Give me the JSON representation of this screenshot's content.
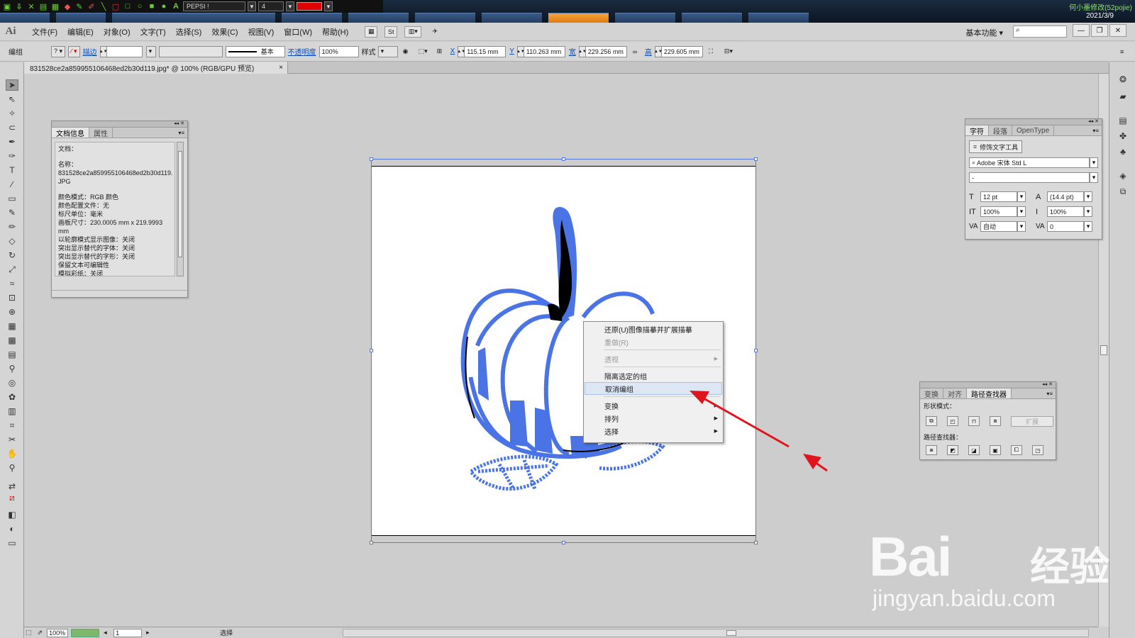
{
  "taskbar": {
    "font_select": "PEPSI !",
    "size_select": "4",
    "color_swatch": "#e00000",
    "user": "何小墨修改(52pojie)",
    "date": "2021/3/9"
  },
  "app": {
    "logo": "Ai",
    "menus": [
      "文件(F)",
      "编辑(E)",
      "对象(O)",
      "文字(T)",
      "选择(S)",
      "效果(C)",
      "视图(V)",
      "窗口(W)",
      "帮助(H)"
    ],
    "br_icon": "St",
    "workspace": "基本功能",
    "search_placeholder": ""
  },
  "control_bar": {
    "group_label": "编组",
    "stroke_label": "描边",
    "stroke_style": "基本",
    "opacity_label": "不透明度",
    "opacity_value": "100%",
    "style_label": "样式",
    "x_label": "X",
    "x_value": "115.15 mm",
    "y_label": "Y",
    "y_value": "110.263 mm",
    "w_label": "宽",
    "w_value": "229.256 mm",
    "h_label": "高",
    "h_value": "229.605 mm"
  },
  "document_tab": {
    "title": "831528ce2a859955106468ed2b30d119.jpg* @ 100% (RGB/GPU 预览)",
    "close": "×"
  },
  "doc_info_panel": {
    "tabs": [
      "文档信息",
      "属性"
    ],
    "lines_a": [
      "文档："
    ],
    "lines_b": [
      "名称：",
      "831528ce2a859955106468ed2b30d119.",
      "JPG"
    ],
    "lines_c": [
      "颜色模式：RGB 颜色",
      "颜色配置文件：无",
      "标尺单位：毫米",
      "画板尺寸：230.0005 mm x 219.9993",
      "mm"
    ],
    "lines_d": [
      "以轮廓模式显示图像：关闭",
      "突出显示替代的字体：关闭",
      "突出显示替代的字形：关闭",
      "保留文本可编辑性",
      "模拟彩纸：关闭"
    ]
  },
  "char_panel": {
    "tabs": [
      "字符",
      "段落",
      "OpenType"
    ],
    "touch_tool": "修饰文字工具",
    "font_family": "Adobe 宋体 Std L",
    "font_style": "-",
    "size": "12 pt",
    "leading": "(14.4 pt)",
    "v_scale": "100%",
    "h_scale": "100%",
    "kerning": "自动",
    "tracking": "0"
  },
  "pathfinder_panel": {
    "tabs": [
      "变换",
      "对齐",
      "路径查找器"
    ],
    "shape_modes_label": "形状模式：",
    "pathfinders_label": "路径查找器：",
    "expand_label": "扩展"
  },
  "context_menu": {
    "items": [
      {
        "label": "还原(U)图像描摹并扩展描摹",
        "disabled": false,
        "submenu": false
      },
      {
        "label": "重做(R)",
        "disabled": true,
        "submenu": false
      },
      {
        "label": "透视",
        "disabled": true,
        "submenu": true
      },
      {
        "label": "隔离选定的组",
        "disabled": false,
        "submenu": false
      },
      {
        "label": "取消编组",
        "disabled": false,
        "submenu": false,
        "highlighted": true
      },
      {
        "label": "变换",
        "disabled": false,
        "submenu": true
      },
      {
        "label": "排列",
        "disabled": false,
        "submenu": true
      },
      {
        "label": "选择",
        "disabled": false,
        "submenu": true
      }
    ]
  },
  "status_bar": {
    "zoom": "100%",
    "artboard": "1",
    "tool": "选择"
  },
  "watermark": {
    "brand": "Bai",
    "brand_cn": "经验",
    "url": "jingyan.baidu.com"
  },
  "colors": {
    "trace_blue": "#4a74e6",
    "trace_black": "#000000",
    "arrow_red": "#e0141c"
  }
}
